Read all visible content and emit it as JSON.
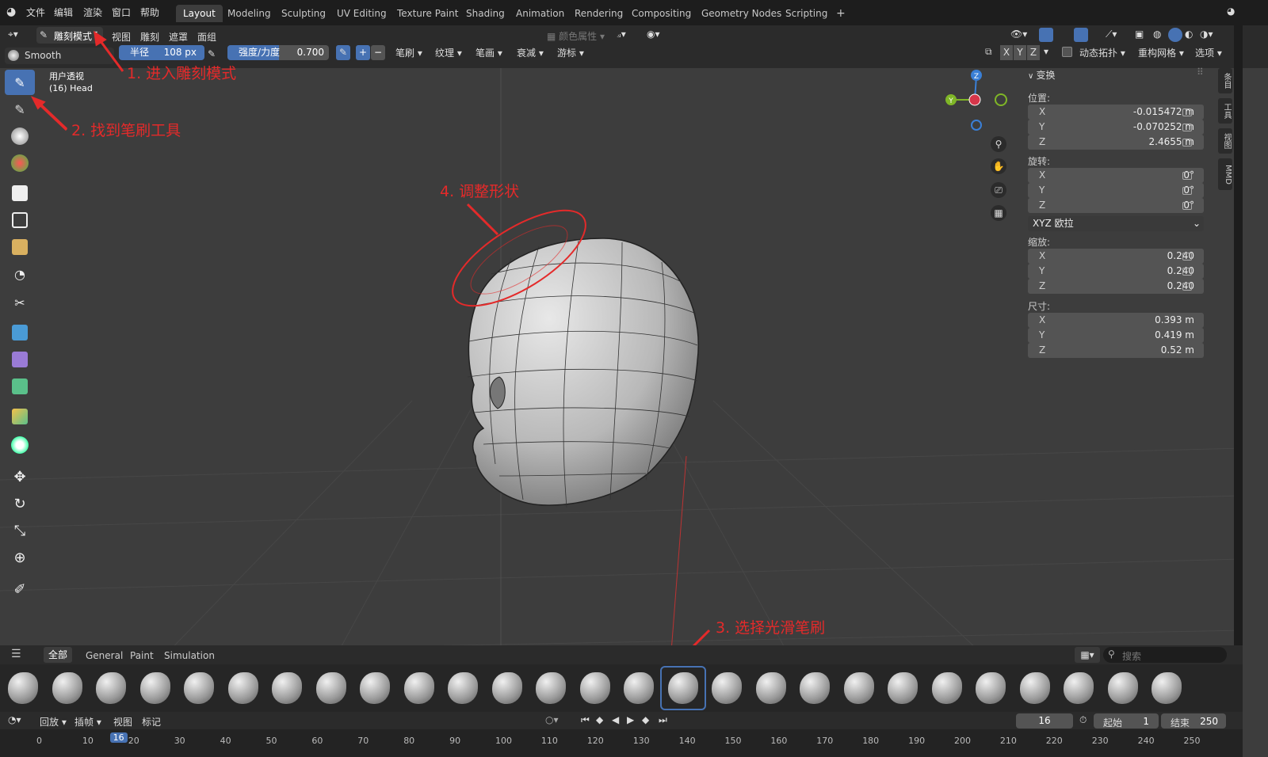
{
  "topbar": {
    "menus": [
      "文件",
      "编辑",
      "渲染",
      "窗口",
      "帮助"
    ],
    "workspaces": [
      "Layout",
      "Modeling",
      "Sculpting",
      "UV Editing",
      "Texture Paint",
      "Shading",
      "Animation",
      "Rendering",
      "Compositing",
      "Geometry Nodes",
      "Scripting"
    ],
    "active_workspace": "Layout",
    "add_tab": "+"
  },
  "header": {
    "mode": "雕刻模式",
    "menus": [
      "视图",
      "雕刻",
      "遮罩",
      "面组"
    ],
    "color_attr": "颜色属性"
  },
  "toolheader": {
    "brush_name": "Smooth",
    "radius_label": "半径",
    "radius_value": "108 px",
    "strength_label": "强度/力度",
    "strength_value": "0.700",
    "strength_fraction": 0.7,
    "plus": "+",
    "minus": "−",
    "dropdowns": [
      "笔刷",
      "纹理",
      "笔画",
      "衰减",
      "游标"
    ],
    "axes": [
      "X",
      "Y",
      "Z"
    ],
    "dyntopo": "动态拓扑",
    "remesh": "重构网格",
    "options": "选项"
  },
  "viewport": {
    "view_name": "用户透视",
    "object_name": "(16) Head",
    "gizmo": {
      "z": "Z",
      "y": "Y"
    }
  },
  "npanel": {
    "section": "变换",
    "location_label": "位置:",
    "location": [
      {
        "axis": "X",
        "value": "-0.015472 m"
      },
      {
        "axis": "Y",
        "value": "-0.070252 m"
      },
      {
        "axis": "Z",
        "value": "2.4655 m"
      }
    ],
    "rotation_label": "旋转:",
    "rotation": [
      {
        "axis": "X",
        "value": "0°"
      },
      {
        "axis": "Y",
        "value": "0°"
      },
      {
        "axis": "Z",
        "value": "0°"
      }
    ],
    "rotation_mode": "XYZ 欧拉",
    "scale_label": "缩放:",
    "scale": [
      {
        "axis": "X",
        "value": "0.240"
      },
      {
        "axis": "Y",
        "value": "0.240"
      },
      {
        "axis": "Z",
        "value": "0.240"
      }
    ],
    "dimensions_label": "尺寸:",
    "dimensions": [
      {
        "axis": "X",
        "value": "0.393 m"
      },
      {
        "axis": "Y",
        "value": "0.419 m"
      },
      {
        "axis": "Z",
        "value": "0.52 m"
      }
    ],
    "side_tabs": [
      "条目",
      "工具",
      "视图",
      "MMD"
    ]
  },
  "brushbar": {
    "tabs": [
      "全部",
      "General",
      "Paint",
      "Simulation"
    ],
    "active_tab": "全部",
    "search_placeholder": "搜索"
  },
  "timeline": {
    "playback": "回放",
    "keying": "插帧",
    "view": "视图",
    "marker": "标记",
    "current_frame": "16",
    "start_label": "起始",
    "start_value": "1",
    "end_label": "结束",
    "end_value": "250",
    "ruler": [
      "0",
      "10",
      "16",
      "20",
      "30",
      "40",
      "50",
      "60",
      "70",
      "80",
      "90",
      "100",
      "110",
      "120",
      "130",
      "140",
      "150",
      "160",
      "170",
      "180",
      "190",
      "200",
      "210",
      "220",
      "230",
      "240",
      "250"
    ]
  },
  "annotations": {
    "step1": "1. 进入雕刻模式",
    "step2": "2. 找到笔刷工具",
    "step3": "3. 选择光滑笔刷",
    "step4": "4. 调整形状"
  },
  "colors": {
    "accent": "#4772b3",
    "annotation": "#e42a2a",
    "x_axis": "#d6364a",
    "y_axis": "#7fb627",
    "z_axis": "#3a7fd6"
  }
}
